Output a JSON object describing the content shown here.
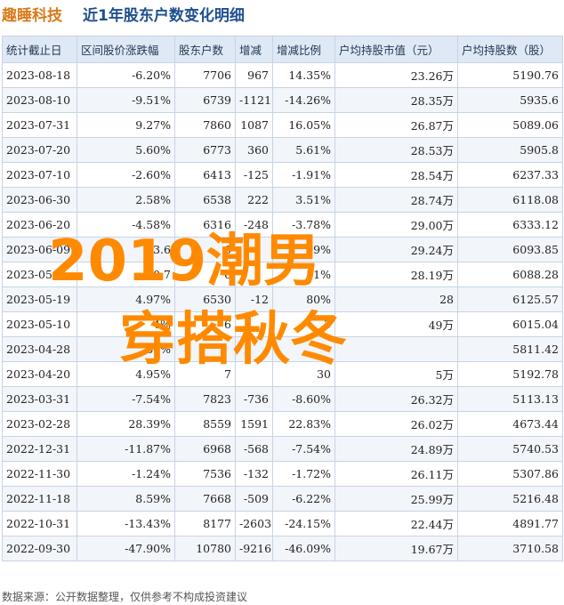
{
  "header": {
    "brand": "趣睡科技",
    "title": "近1年股东户数变化明细"
  },
  "chart_data": {
    "type": "table",
    "columns": [
      "统计截止日",
      "区间股价涨跌幅",
      "股东户数",
      "增减",
      "增减比例",
      "户均持股市值（元）",
      "户均持股数（股）"
    ],
    "rows": [
      [
        "2023-08-18",
        "-6.20%",
        "7706",
        "967",
        "14.35%",
        "23.26万",
        "5190.76"
      ],
      [
        "2023-08-10",
        "-9.51%",
        "6739",
        "-1121",
        "-14.26%",
        "28.35万",
        "5935.6"
      ],
      [
        "2023-07-31",
        "9.27%",
        "7860",
        "1087",
        "16.05%",
        "26.87万",
        "5089.06"
      ],
      [
        "2023-07-20",
        "5.60%",
        "6773",
        "360",
        "5.61%",
        "28.53万",
        "5905.8"
      ],
      [
        "2023-07-10",
        "-2.60%",
        "6413",
        "-125",
        "-1.91%",
        "28.54万",
        "6237.33"
      ],
      [
        "2023-06-30",
        "2.58%",
        "6538",
        "222",
        "3.51%",
        "28.74万",
        "6118.08"
      ],
      [
        "2023-06-20",
        "-4.58%",
        "6316",
        "-248",
        "-3.78%",
        "29.00万",
        "6333.12"
      ],
      [
        "2023-06-09",
        "3.6",
        "6",
        "",
        "09%",
        "29.24万",
        "6093.85"
      ],
      [
        "2023-05-",
        "0.7",
        "6",
        "",
        "51%",
        "28.19万",
        "6088.28"
      ],
      [
        "2023-05-19",
        "4.97%",
        "6530",
        "-12",
        "80%",
        "28",
        "6125.57"
      ],
      [
        "2023-05-10",
        "4%",
        "6",
        "",
        "3",
        "49万",
        "6015.04"
      ],
      [
        "2023-04-28",
        "60%",
        "",
        "",
        "",
        "",
        "5811.42"
      ],
      [
        "2023-04-20",
        "4.95%",
        "7",
        "",
        "30",
        "5万",
        "5192.78"
      ],
      [
        "2023-03-31",
        "-7.54%",
        "7823",
        "-736",
        "-8.60%",
        "26.32万",
        "5113.13"
      ],
      [
        "2023-02-28",
        "28.39%",
        "8559",
        "1591",
        "22.83%",
        "26.02万",
        "4673.44"
      ],
      [
        "2022-12-31",
        "-11.87%",
        "6968",
        "-568",
        "-7.54%",
        "24.89万",
        "5740.53"
      ],
      [
        "2022-11-30",
        "-1.24%",
        "7536",
        "-132",
        "-1.72%",
        "26.11万",
        "5307.86"
      ],
      [
        "2022-11-18",
        "8.59%",
        "7668",
        "-509",
        "-6.22%",
        "25.99万",
        "5216.48"
      ],
      [
        "2022-10-31",
        "-13.43%",
        "8177",
        "-2603",
        "-24.15%",
        "22.44万",
        "4891.77"
      ],
      [
        "2022-09-30",
        "-47.90%",
        "10780",
        "-9216",
        "-46.09%",
        "19.67万",
        "3710.58"
      ]
    ],
    "colors": {
      "positive": "#e01b1b",
      "negative": "#1a9a2a",
      "header_bg": "#dfe9f5",
      "overlay": "#ff8a00"
    }
  },
  "overlay": {
    "line1": "2019潮男",
    "line2": "穿搭秋冬"
  },
  "footer": {
    "source": "数据来源：公开数据整理，仅供参考不构成投资建议"
  }
}
